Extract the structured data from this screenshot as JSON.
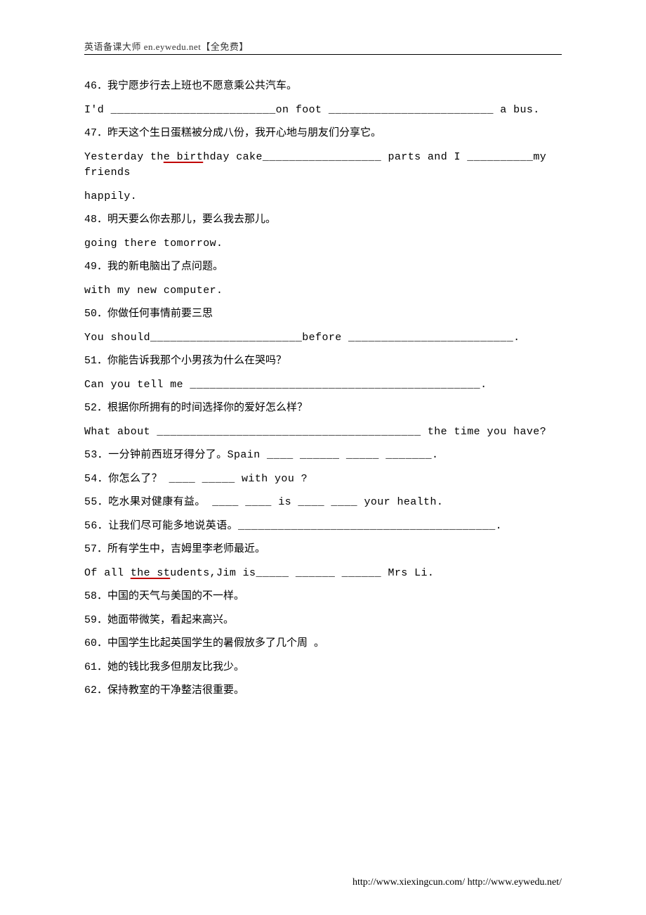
{
  "header": "英语备课大师 en.eywedu.net【全免费】",
  "lines": {
    "l46a": "46．我宁愿步行去上班也不愿意乘公共汽车。",
    "l46b_a": "I'd _________________________on foot _________________________ a bus.",
    "l47a": "47．昨天这个生日蛋糕被分成八份，我开心地与朋友们分享它。",
    "l47b_pre": "Yesterday th",
    "l47b_uspan": "e birt",
    "l47b_post": "hday cake__________________ parts and I __________my friends",
    "l47c": "happily.",
    "l48a": "48．明天要么你去那儿，要么我去那儿。",
    "l48b": "going there tomorrow.",
    "l49a": "49．我的新电脑出了点问题。",
    "l49b": "with my new computer.",
    "l50a": "50．你做任何事情前要三思",
    "l50b": "You should_______________________before _________________________.",
    "l51a": "51．你能告诉我那个小男孩为什么在哭吗？",
    "l51b": "Can you tell me ____________________________________________.",
    "l52a": "52．根据你所拥有的时间选择你的爱好怎么样？",
    "l52b": "What about ________________________________________ the time you have?",
    "l53": "53．一分钟前西班牙得分了。Spain ____ ______ _____ _______.",
    "l54": "54．你怎么了？ ____ _____ with you ?",
    "l55": "55．吃水果对健康有益。 ____ ____ is ____ ____ your health.",
    "l56": "56．让我们尽可能多地说英语。_______________________________________.",
    "l57a": "57．所有学生中，吉姆里李老师最近。",
    "l57b_pre": "Of all ",
    "l57b_uspan": "the st",
    "l57b_post": "udents,Jim is_____   ______  ______ Mrs Li.",
    "l58": "58．中国的天气与美国的不一样。",
    "l59": "59．她面带微笑，看起来高兴。",
    "l60": "60．中国学生比起英国学生的暑假放多了几个周 。",
    "l61": "61．她的钱比我多但朋友比我少。",
    "l62": "62．保持教室的干净整洁很重要。"
  },
  "footer": "http://www.xiexingcun.com/ http://www.eywedu.net/"
}
